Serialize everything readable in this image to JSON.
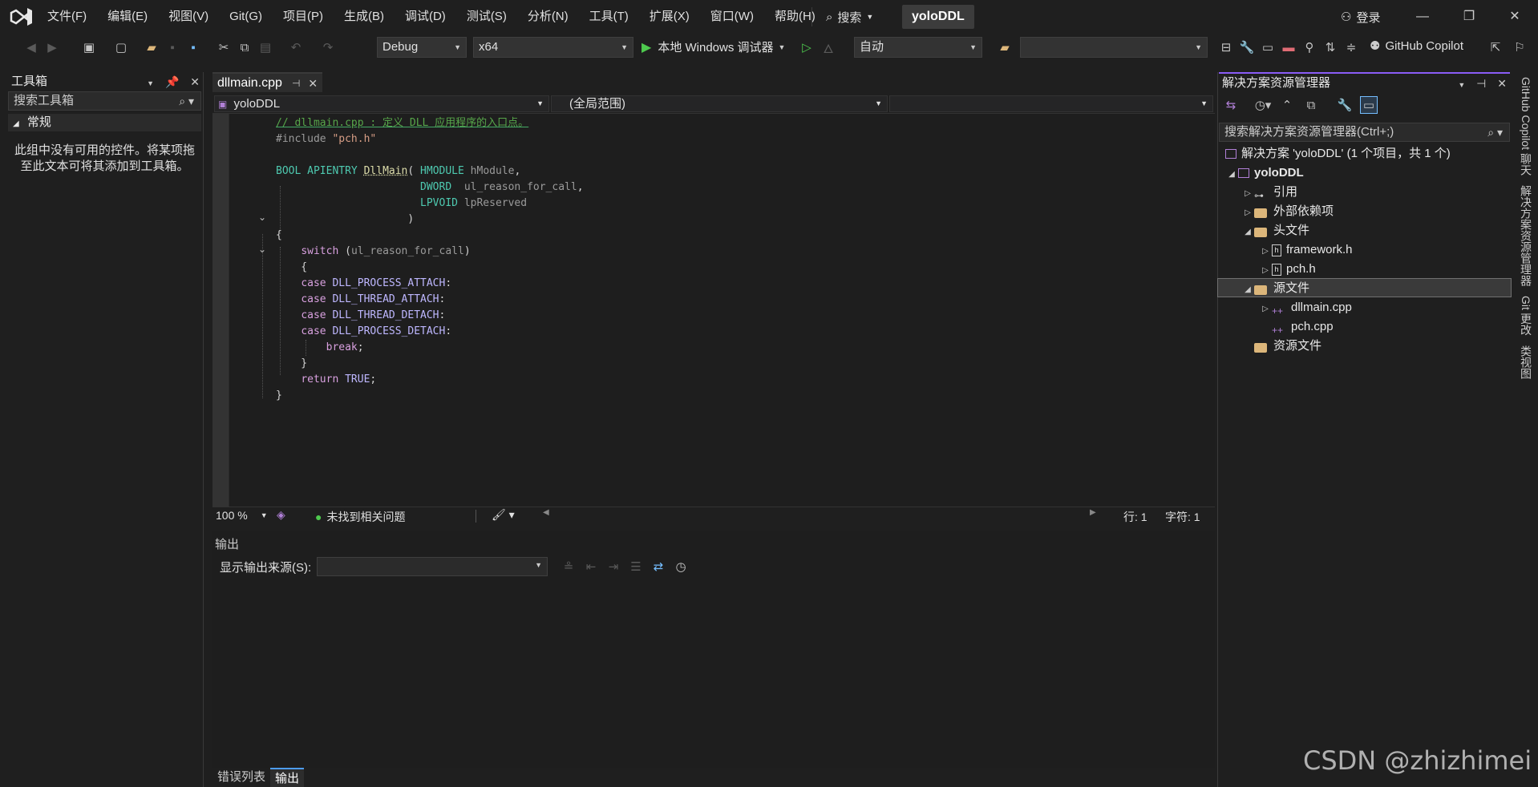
{
  "menu": [
    "文件(F)",
    "编辑(E)",
    "视图(V)",
    "Git(G)",
    "项目(P)",
    "生成(B)",
    "调试(D)",
    "测试(S)",
    "分析(N)",
    "工具(T)",
    "扩展(X)",
    "窗口(W)",
    "帮助(H)"
  ],
  "search_label": "搜索",
  "project_badge": "yoloDDL",
  "login_label": "登录",
  "toolbar": {
    "config": "Debug",
    "platform": "x64",
    "run_label": "本地 Windows 调试器",
    "auto": "自动",
    "copilot": "GitHub Copilot"
  },
  "toolbox": {
    "title": "工具箱",
    "search_placeholder": "搜索工具箱",
    "section": "常规",
    "empty_text": "此组中没有可用的控件。将某项拖至此文本可将其添加到工具箱。"
  },
  "editor": {
    "tab": "dllmain.cpp",
    "nav_project": "yoloDDL",
    "nav_scope": "(全局范围)",
    "zoom": "100 %",
    "issues": "未找到相关问题",
    "line": "行: 1",
    "col": "字符: 1"
  },
  "output": {
    "title": "输出",
    "source_label": "显示输出来源(S):"
  },
  "bottom_tabs": [
    "错误列表",
    "输出"
  ],
  "solution": {
    "title": "解决方案资源管理器",
    "search_placeholder": "搜索解决方案资源管理器(Ctrl+;)",
    "root": "解决方案 'yoloDDL' (1 个项目，共 1 个)",
    "project": "yoloDDL",
    "refs": "引用",
    "external": "外部依赖项",
    "headers": "头文件",
    "framework": "framework.h",
    "pch_h": "pch.h",
    "sources": "源文件",
    "dllmain": "dllmain.cpp",
    "pch_cpp": "pch.cpp",
    "resources": "资源文件"
  },
  "vertical_tabs": [
    "GitHub Copilot 聊天",
    "解决方案资源管理器",
    "Git 更改",
    "类视图"
  ],
  "watermark": "CSDN @zhizhimei"
}
